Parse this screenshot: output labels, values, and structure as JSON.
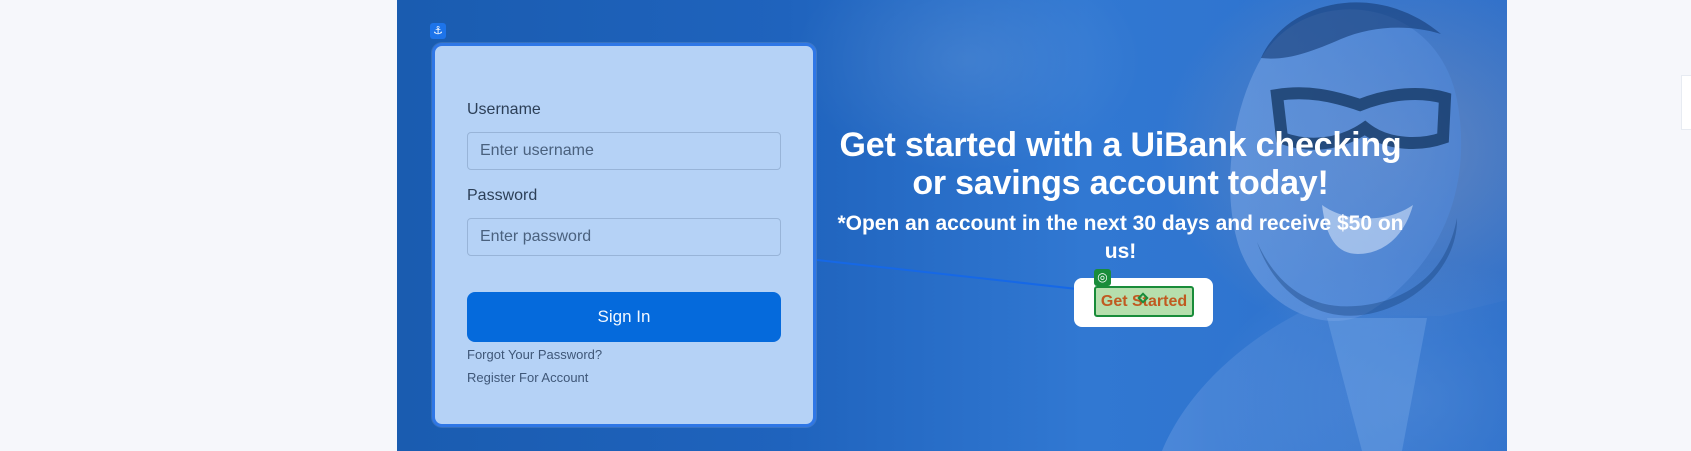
{
  "login": {
    "username_label": "Username",
    "username_placeholder": "Enter username",
    "password_label": "Password",
    "password_placeholder": "Enter password",
    "signin_label": "Sign In",
    "forgot_label": "Forgot Your Password?",
    "register_label": "Register For Account"
  },
  "hero": {
    "title": "Get started with a UiBank checking or savings account today!",
    "subtitle": "*Open an account in the next 30 days and receive $50 on us!"
  },
  "cta": {
    "label": "Get Started"
  },
  "icons": {
    "anchor": "anchor-icon",
    "target": "target-icon",
    "handle": "handle-icon"
  },
  "colors": {
    "hero_blue": "#1f63bd",
    "card_blue": "#b5d2f6",
    "button_blue": "#056adc",
    "green": "#198c3a",
    "orange": "#c05a20",
    "page_bg": "#f6f7fb"
  }
}
